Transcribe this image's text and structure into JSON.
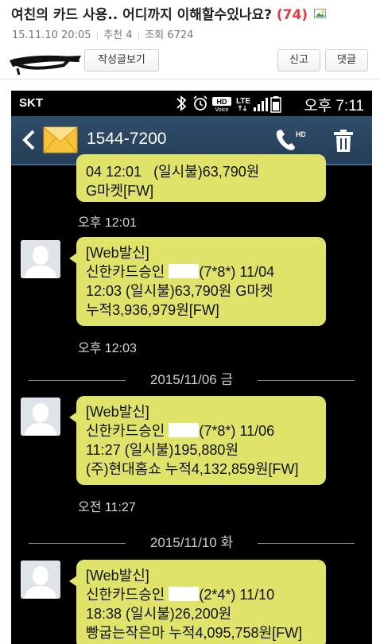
{
  "post": {
    "title": "여친의 카드 사용.. 어디까지 이해할수있나요?",
    "comment_count": "(74)",
    "date": "15.11.10 20:05",
    "recommend": "추천 4",
    "views": "조회 6724"
  },
  "buttons": {
    "view_posts": "작성글보기",
    "report": "신고",
    "reply": "댓글"
  },
  "phone": {
    "status": {
      "carrier": "SKT",
      "time": "오후 7:11"
    },
    "header": {
      "number": "1544-7200"
    },
    "messages": [
      {
        "lines": [
          "04 12:01   (일시불)63,790원",
          "G마켓[FW]"
        ],
        "time": "오후 12:01"
      },
      {
        "line1": "[Web발신]",
        "line2_pre": "신한카드승인 ",
        "line2_post": "(7*8*) 11/04",
        "line3": "12:03 (일시불)63,790원 G마켓",
        "line4": "누적3,936,979원[FW]",
        "time": "오후 12:03"
      },
      {
        "line1": "[Web발신]",
        "line2_pre": "신한카드승인 ",
        "line2_post": "(7*8*) 11/06",
        "line3": "11:27 (일시불)195,880원",
        "line4": "(주)현대홈쇼 누적4,132,859원[FW]",
        "time": "오전 11:27"
      },
      {
        "line1": "[Web발신]",
        "line2_pre": "신한카드승인 ",
        "line2_post": "(2*4*) 11/10",
        "line3": "18:38 (일시불)26,200원",
        "line4": "빵굽는작은마 누적4,095,758원[FW]"
      }
    ],
    "date_separators": [
      "2015/11/06 금",
      "2015/11/10 화"
    ]
  }
}
